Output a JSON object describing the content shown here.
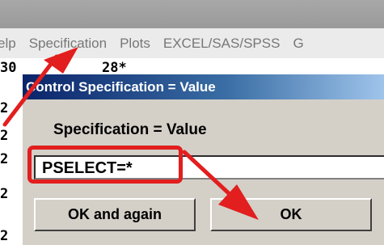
{
  "menubar": {
    "items": [
      "elp",
      "Specification",
      "Plots",
      "EXCEL/SAS/SPSS",
      "G"
    ]
  },
  "background_text": {
    "row1_a": "30",
    "row1_b": "28*",
    "margin_chars": [
      "2",
      "2",
      "2",
      "2",
      "2"
    ]
  },
  "dialog": {
    "title": "Control Specification = Value",
    "label": "Specification = Value",
    "input_value": "PSELECT=*",
    "ok_again_label": "OK and again",
    "ok_label": "OK"
  },
  "colors": {
    "annotation_red": "#e21e1e",
    "title_bar_dark": "#0a246a",
    "dialog_face": "#d4d0c8"
  },
  "icons": {
    "arrow_to_menu": "red-arrow-icon",
    "arrow_to_ok": "red-arrow-icon"
  }
}
